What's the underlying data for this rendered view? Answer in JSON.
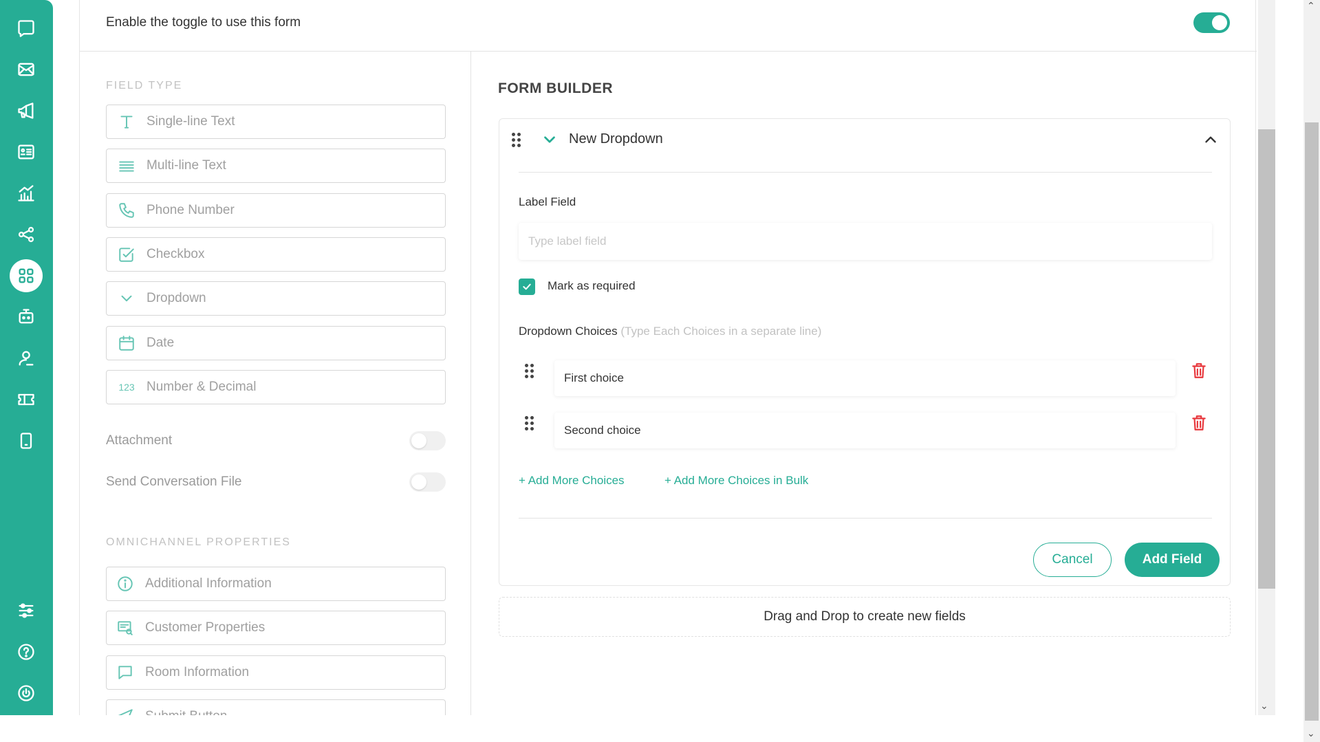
{
  "colors": {
    "accent": "#26ad95",
    "danger": "#e8383d"
  },
  "sidebar": {
    "items": [
      {
        "icon": "chat-icon"
      },
      {
        "icon": "mail-icon"
      },
      {
        "icon": "megaphone-icon"
      },
      {
        "icon": "contact-card-icon"
      },
      {
        "icon": "analytics-icon"
      },
      {
        "icon": "share-icon"
      },
      {
        "icon": "apps-grid-icon",
        "active": true
      },
      {
        "icon": "bot-icon"
      },
      {
        "icon": "agent-icon"
      },
      {
        "icon": "ticket-icon"
      },
      {
        "icon": "mobile-icon"
      },
      {
        "icon": "settings-sliders-icon"
      },
      {
        "icon": "help-icon"
      },
      {
        "icon": "power-icon"
      }
    ]
  },
  "topbar": {
    "text": "Enable the toggle to use this form",
    "toggle_on": true
  },
  "left": {
    "field_type_label": "FIELD TYPE",
    "field_types": [
      {
        "label": "Single-line Text",
        "icon": "text-icon"
      },
      {
        "label": "Multi-line Text",
        "icon": "lines-icon"
      },
      {
        "label": "Phone Number",
        "icon": "phone-icon"
      },
      {
        "label": "Checkbox",
        "icon": "checkbox-icon"
      },
      {
        "label": "Dropdown",
        "icon": "chevron-down-icon"
      },
      {
        "label": "Date",
        "icon": "calendar-icon"
      },
      {
        "label": "Number & Decimal",
        "icon": "number-icon",
        "glyph": "123"
      }
    ],
    "toggles": [
      {
        "label": "Attachment",
        "on": false
      },
      {
        "label": "Send Conversation File",
        "on": false
      }
    ],
    "omni_label": "OMNICHANNEL PROPERTIES",
    "omni_items": [
      {
        "label": "Additional Information",
        "icon": "info-icon"
      },
      {
        "label": "Customer Properties",
        "icon": "customer-properties-icon"
      },
      {
        "label": "Room Information",
        "icon": "chat-bubble-icon"
      },
      {
        "label": "Submit Button",
        "icon": "send-icon"
      }
    ]
  },
  "builder": {
    "title": "FORM BUILDER",
    "card_title": "New Dropdown",
    "label_field": "Label Field",
    "label_placeholder": "Type label field",
    "required_label": "Mark as required",
    "required_checked": true,
    "choices_label": "Dropdown Choices",
    "choices_hint": "(Type Each Choices in a separate line)",
    "choices": [
      "First choice",
      "Second choice"
    ],
    "add_more": "+ Add More Choices",
    "add_bulk": "+ Add More Choices in Bulk",
    "cancel": "Cancel",
    "add_field": "Add Field",
    "dropzone": "Drag and Drop to create new fields"
  }
}
